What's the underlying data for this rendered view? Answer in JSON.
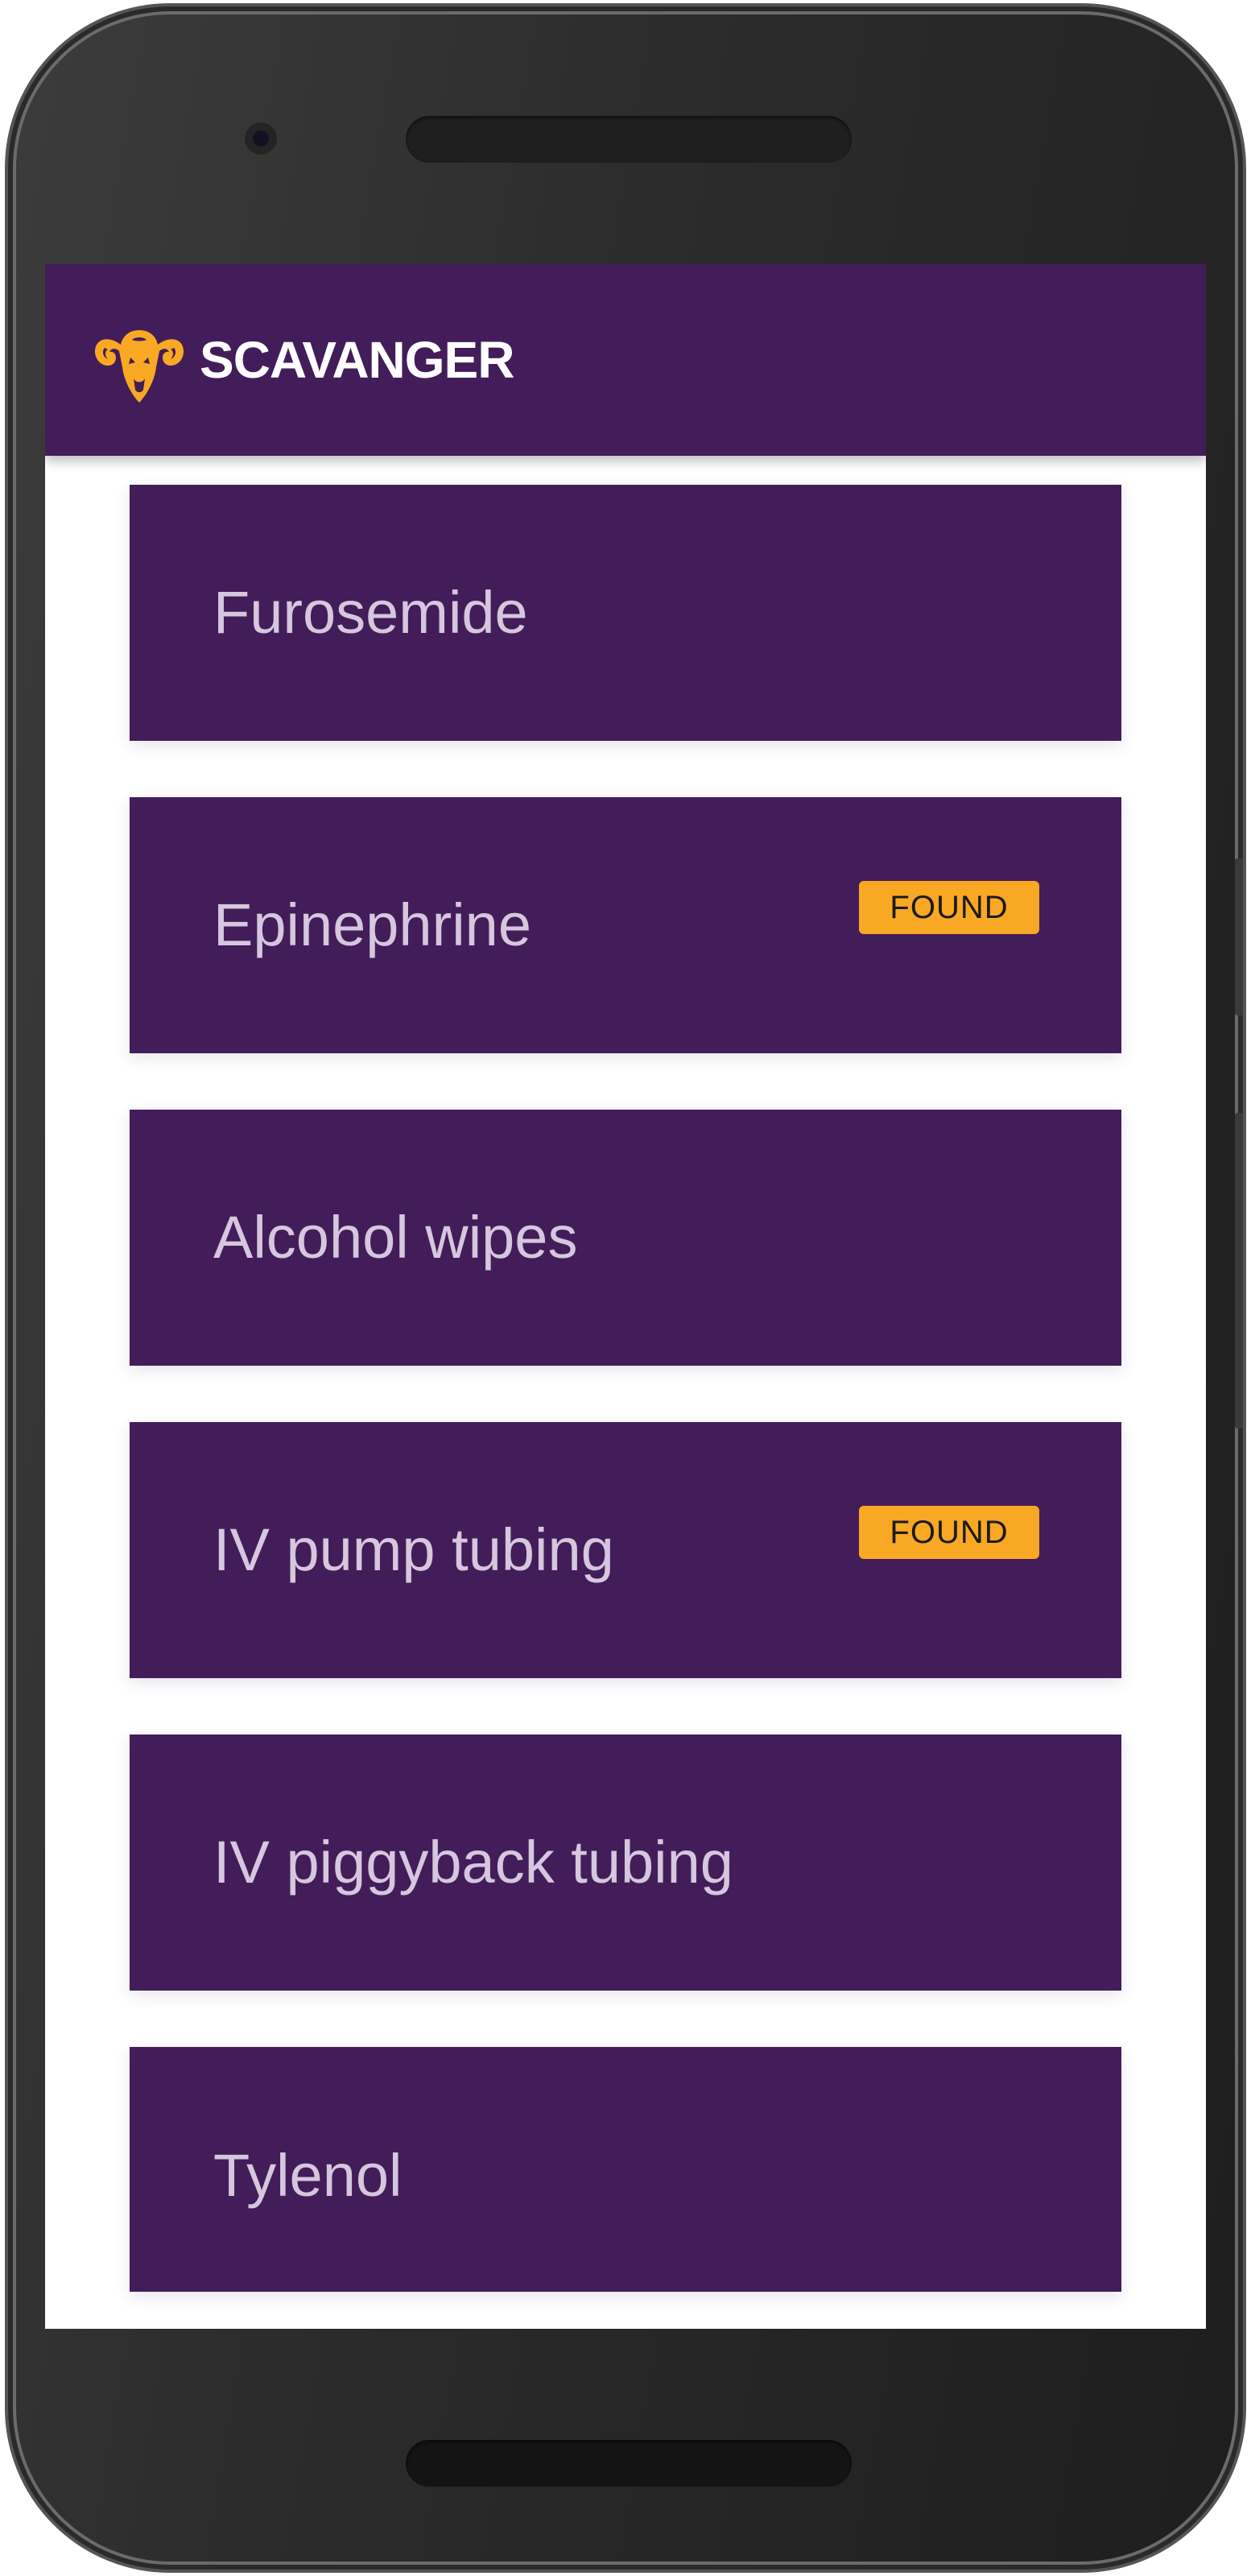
{
  "app": {
    "title": "SCAVANGER",
    "logo_icon": "ram-head-icon",
    "brand_color": "#421d59",
    "accent_color": "#f9a823"
  },
  "items": [
    {
      "label": "Furosemide",
      "found": false
    },
    {
      "label": "Epinephrine",
      "found": true,
      "badge": "FOUND"
    },
    {
      "label": "Alcohol wipes",
      "found": false
    },
    {
      "label": "IV pump tubing",
      "found": true,
      "badge": "FOUND"
    },
    {
      "label": "IV piggyback tubing",
      "found": false
    },
    {
      "label": "Tylenol",
      "found": false
    }
  ]
}
